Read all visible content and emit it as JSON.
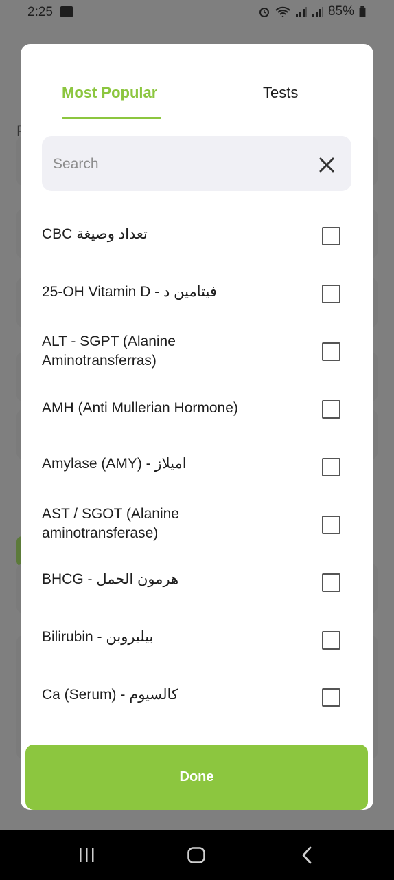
{
  "status_bar": {
    "time": "2:25",
    "battery": "85%",
    "icons": [
      "image-icon",
      "alarm-icon",
      "wifi-icon",
      "signal-icon",
      "signal-icon",
      "battery-icon"
    ]
  },
  "background": {
    "partial_text": "F"
  },
  "modal": {
    "tabs": [
      {
        "label": "Most Popular",
        "active": true
      },
      {
        "label": "Tests",
        "active": false
      }
    ],
    "search": {
      "placeholder": "Search",
      "value": "",
      "clear_icon": "close-icon"
    },
    "items": [
      {
        "label": "CBC تعداد وصيغة",
        "checked": false
      },
      {
        "label": "25-OH Vitamin D - فيتامين د",
        "checked": false
      },
      {
        "label": "ALT - SGPT (Alanine Aminotransferras)",
        "checked": false
      },
      {
        "label": "AMH (Anti Mullerian Hormone)",
        "checked": false
      },
      {
        "label": "Amylase (AMY) - اميلاز",
        "checked": false
      },
      {
        "label": "AST / SGOT (Alanine aminotransferase)",
        "checked": false
      },
      {
        "label": "BHCG - هرمون الحمل",
        "checked": false
      },
      {
        "label": "Bilirubin - بيليروبن",
        "checked": false
      },
      {
        "label": "Ca (Serum) - كالسيوم",
        "checked": false
      }
    ],
    "done_label": "Done"
  },
  "colors": {
    "accent": "#8cc63f",
    "dark_green": "#44601f"
  }
}
